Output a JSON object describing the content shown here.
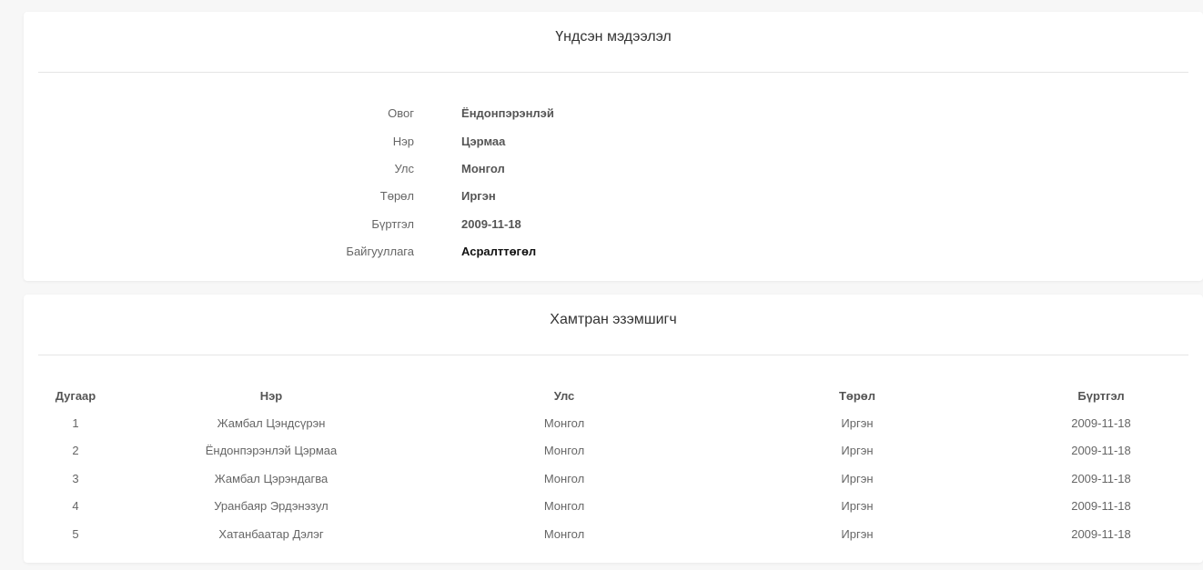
{
  "basic_info": {
    "title": "Үндсэн мэдээлэл",
    "rows": [
      {
        "label": "Овог",
        "value": "Ёндонпэрэнлэй"
      },
      {
        "label": "Нэр",
        "value": "Цэрмаа"
      },
      {
        "label": "Улс",
        "value": "Монгол"
      },
      {
        "label": "Төрөл",
        "value": "Иргэн"
      },
      {
        "label": "Бүртгэл",
        "value": "2009-11-18"
      },
      {
        "label": "Байгууллага",
        "value": "Асралттөгөл"
      }
    ]
  },
  "co_owners": {
    "title": "Хамтран эзэмшигч",
    "headers": [
      "Дугаар",
      "Нэр",
      "Улс",
      "Төрөл",
      "Бүртгэл"
    ],
    "rows": [
      [
        "1",
        "Жамбал Цэндсүрэн",
        "Монгол",
        "Иргэн",
        "2009-11-18"
      ],
      [
        "2",
        "Ёндонпэрэнлэй Цэрмаа",
        "Монгол",
        "Иргэн",
        "2009-11-18"
      ],
      [
        "3",
        "Жамбал Цэрэндагва",
        "Монгол",
        "Иргэн",
        "2009-11-18"
      ],
      [
        "4",
        "Уранбаяр Эрдэнэзул",
        "Монгол",
        "Иргэн",
        "2009-11-18"
      ],
      [
        "5",
        "Хатанбаатар Дэлэг",
        "Монгол",
        "Иргэн",
        "2009-11-18"
      ]
    ]
  }
}
